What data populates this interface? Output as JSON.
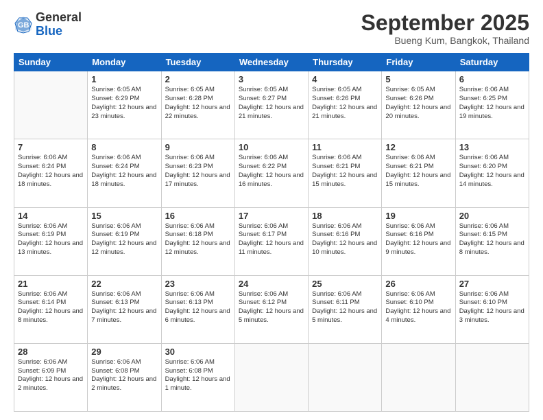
{
  "header": {
    "logo_general": "General",
    "logo_blue": "Blue",
    "month_title": "September 2025",
    "location": "Bueng Kum, Bangkok, Thailand"
  },
  "weekdays": [
    "Sunday",
    "Monday",
    "Tuesday",
    "Wednesday",
    "Thursday",
    "Friday",
    "Saturday"
  ],
  "weeks": [
    [
      {
        "day": "",
        "empty": true
      },
      {
        "day": "1",
        "sunrise": "6:05 AM",
        "sunset": "6:29 PM",
        "daylight": "12 hours and 23 minutes."
      },
      {
        "day": "2",
        "sunrise": "6:05 AM",
        "sunset": "6:28 PM",
        "daylight": "12 hours and 22 minutes."
      },
      {
        "day": "3",
        "sunrise": "6:05 AM",
        "sunset": "6:27 PM",
        "daylight": "12 hours and 21 minutes."
      },
      {
        "day": "4",
        "sunrise": "6:05 AM",
        "sunset": "6:26 PM",
        "daylight": "12 hours and 21 minutes."
      },
      {
        "day": "5",
        "sunrise": "6:05 AM",
        "sunset": "6:26 PM",
        "daylight": "12 hours and 20 minutes."
      },
      {
        "day": "6",
        "sunrise": "6:06 AM",
        "sunset": "6:25 PM",
        "daylight": "12 hours and 19 minutes."
      }
    ],
    [
      {
        "day": "7",
        "sunrise": "6:06 AM",
        "sunset": "6:24 PM",
        "daylight": "12 hours and 18 minutes."
      },
      {
        "day": "8",
        "sunrise": "6:06 AM",
        "sunset": "6:24 PM",
        "daylight": "12 hours and 18 minutes."
      },
      {
        "day": "9",
        "sunrise": "6:06 AM",
        "sunset": "6:23 PM",
        "daylight": "12 hours and 17 minutes."
      },
      {
        "day": "10",
        "sunrise": "6:06 AM",
        "sunset": "6:22 PM",
        "daylight": "12 hours and 16 minutes."
      },
      {
        "day": "11",
        "sunrise": "6:06 AM",
        "sunset": "6:21 PM",
        "daylight": "12 hours and 15 minutes."
      },
      {
        "day": "12",
        "sunrise": "6:06 AM",
        "sunset": "6:21 PM",
        "daylight": "12 hours and 15 minutes."
      },
      {
        "day": "13",
        "sunrise": "6:06 AM",
        "sunset": "6:20 PM",
        "daylight": "12 hours and 14 minutes."
      }
    ],
    [
      {
        "day": "14",
        "sunrise": "6:06 AM",
        "sunset": "6:19 PM",
        "daylight": "12 hours and 13 minutes."
      },
      {
        "day": "15",
        "sunrise": "6:06 AM",
        "sunset": "6:19 PM",
        "daylight": "12 hours and 12 minutes."
      },
      {
        "day": "16",
        "sunrise": "6:06 AM",
        "sunset": "6:18 PM",
        "daylight": "12 hours and 12 minutes."
      },
      {
        "day": "17",
        "sunrise": "6:06 AM",
        "sunset": "6:17 PM",
        "daylight": "12 hours and 11 minutes."
      },
      {
        "day": "18",
        "sunrise": "6:06 AM",
        "sunset": "6:16 PM",
        "daylight": "12 hours and 10 minutes."
      },
      {
        "day": "19",
        "sunrise": "6:06 AM",
        "sunset": "6:16 PM",
        "daylight": "12 hours and 9 minutes."
      },
      {
        "day": "20",
        "sunrise": "6:06 AM",
        "sunset": "6:15 PM",
        "daylight": "12 hours and 8 minutes."
      }
    ],
    [
      {
        "day": "21",
        "sunrise": "6:06 AM",
        "sunset": "6:14 PM",
        "daylight": "12 hours and 8 minutes."
      },
      {
        "day": "22",
        "sunrise": "6:06 AM",
        "sunset": "6:13 PM",
        "daylight": "12 hours and 7 minutes."
      },
      {
        "day": "23",
        "sunrise": "6:06 AM",
        "sunset": "6:13 PM",
        "daylight": "12 hours and 6 minutes."
      },
      {
        "day": "24",
        "sunrise": "6:06 AM",
        "sunset": "6:12 PM",
        "daylight": "12 hours and 5 minutes."
      },
      {
        "day": "25",
        "sunrise": "6:06 AM",
        "sunset": "6:11 PM",
        "daylight": "12 hours and 5 minutes."
      },
      {
        "day": "26",
        "sunrise": "6:06 AM",
        "sunset": "6:10 PM",
        "daylight": "12 hours and 4 minutes."
      },
      {
        "day": "27",
        "sunrise": "6:06 AM",
        "sunset": "6:10 PM",
        "daylight": "12 hours and 3 minutes."
      }
    ],
    [
      {
        "day": "28",
        "sunrise": "6:06 AM",
        "sunset": "6:09 PM",
        "daylight": "12 hours and 2 minutes."
      },
      {
        "day": "29",
        "sunrise": "6:06 AM",
        "sunset": "6:08 PM",
        "daylight": "12 hours and 2 minutes."
      },
      {
        "day": "30",
        "sunrise": "6:06 AM",
        "sunset": "6:08 PM",
        "daylight": "12 hours and 1 minute."
      },
      {
        "day": "",
        "empty": true
      },
      {
        "day": "",
        "empty": true
      },
      {
        "day": "",
        "empty": true
      },
      {
        "day": "",
        "empty": true
      }
    ]
  ]
}
